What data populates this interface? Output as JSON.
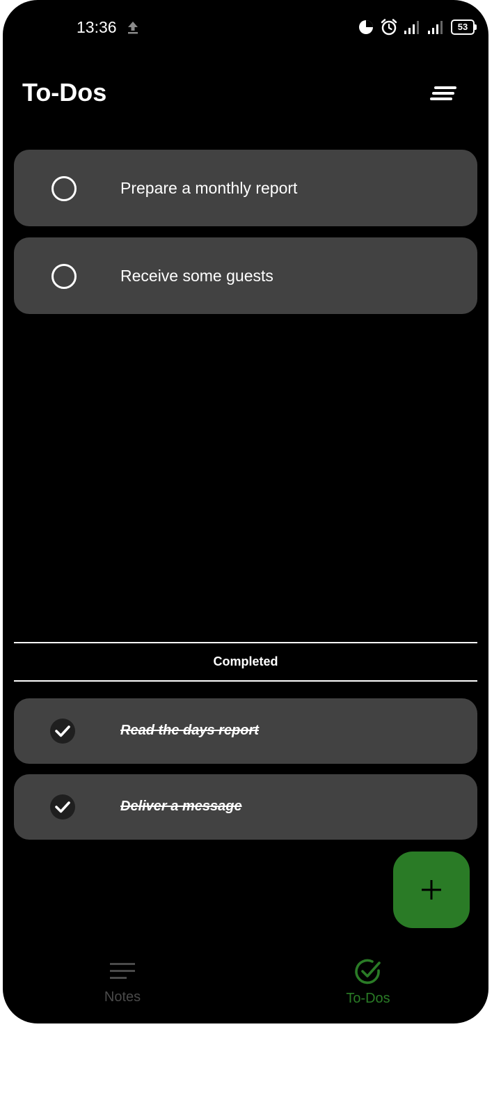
{
  "status_bar": {
    "time": "13:36",
    "battery": "53"
  },
  "header": {
    "title": "To-Dos"
  },
  "todos": [
    {
      "label": "Prepare a monthly report",
      "completed": false
    },
    {
      "label": "Receive some guests",
      "completed": false
    }
  ],
  "completed_section": {
    "title": "Completed",
    "items": [
      {
        "label": "Read the days report",
        "completed": true
      },
      {
        "label": "Deliver a message",
        "completed": true
      }
    ]
  },
  "bottom_nav": {
    "items": [
      {
        "label": "Notes",
        "icon": "notes-icon",
        "active": false
      },
      {
        "label": "To-Dos",
        "icon": "check-circle-icon",
        "active": true
      }
    ]
  },
  "colors": {
    "background": "#000000",
    "card": "#424242",
    "accent": "#2a7b26",
    "inactive": "#4a4a4a"
  },
  "icons": {
    "sort": "sort-icon",
    "add": "plus-icon",
    "upload": "upload-icon"
  }
}
